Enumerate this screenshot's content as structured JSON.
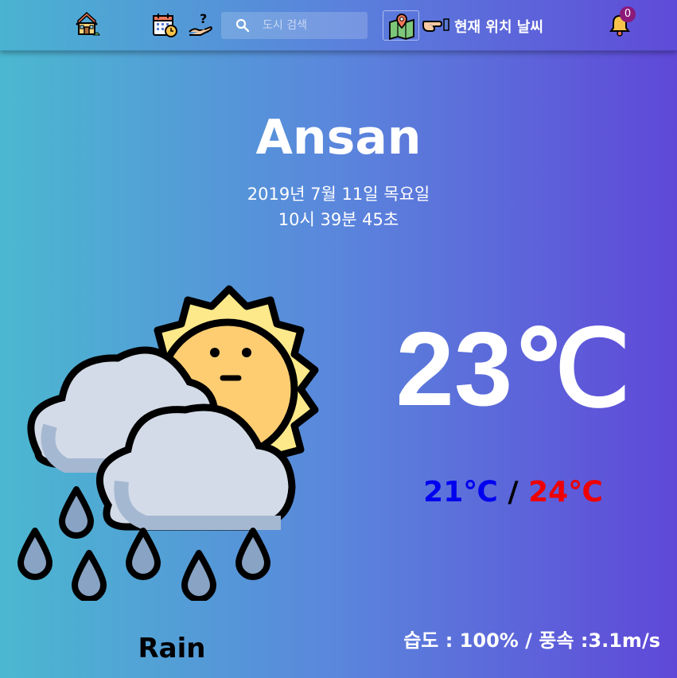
{
  "nav": {
    "home_icon": "house-icon",
    "calendar_icon": "calendar-clock-icon",
    "help_icon": "question-hand-icon",
    "search": {
      "icon": "search-icon",
      "placeholder": "도시 검색",
      "value": ""
    },
    "location_icon": "map-pin-icon",
    "pointing_icon": "pointing-hand-icon",
    "location_label": "현재 위치 날씨",
    "bell_icon": "bell-icon",
    "notification_count": "0"
  },
  "weather": {
    "city": "Ansan",
    "date": "2019년 7월 11일 목요일",
    "time": "10시 39분 45초",
    "icon": "sun-cloud-rain-icon",
    "temperature": "23℃",
    "temp_min": "21℃",
    "separator": "/",
    "temp_max": "24℃",
    "description": "Rain",
    "details": "습도 : 100% / 풍속 :3.1m/s"
  },
  "colors": {
    "gradient_start": "#4bb8d0",
    "gradient_end": "#5f48d8",
    "temp_min": "#0000ee",
    "temp_max": "#ee0000",
    "badge": "#8b1a7a"
  }
}
